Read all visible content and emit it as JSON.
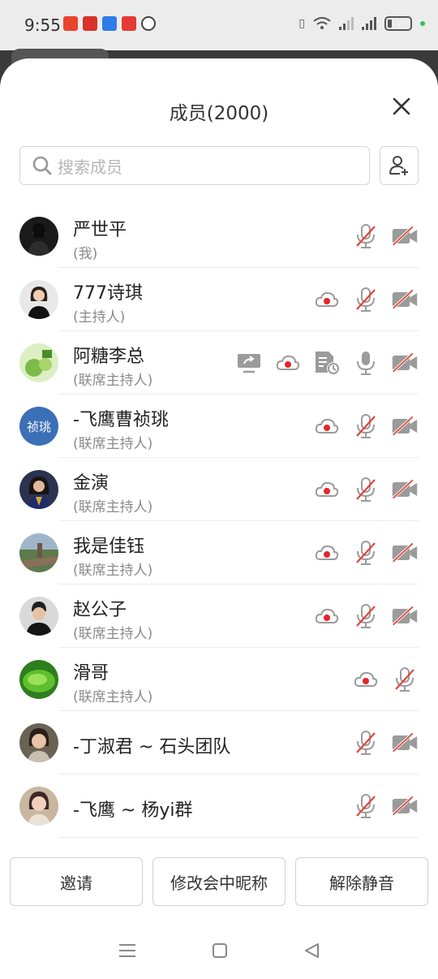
{
  "status_bar": {
    "time": "9:55"
  },
  "sheet": {
    "title": "成员(2000)",
    "search_placeholder": "搜索成员"
  },
  "members": [
    {
      "name": "严世平",
      "role": "(我)",
      "avatar_kind": "photo-dark",
      "icons": [
        "mic-muted-icon",
        "video-off-icon"
      ]
    },
    {
      "name": "777诗琪",
      "role": "(主持人)",
      "avatar_kind": "photo-light",
      "icons": [
        "cloud-record-icon",
        "mic-muted-icon",
        "video-off-icon"
      ]
    },
    {
      "name": "阿糖李总",
      "role": "(联席主持人)",
      "avatar_kind": "photo-green",
      "icons": [
        "screen-share-icon",
        "cloud-record-icon",
        "document-icon",
        "mic-icon",
        "video-off-icon"
      ]
    },
    {
      "name": "-飞鹰曹祯珧",
      "role": "(联席主持人)",
      "avatar_kind": "text",
      "avatar_text": "祯珧",
      "icons": [
        "cloud-record-icon",
        "mic-muted-icon",
        "video-off-icon"
      ]
    },
    {
      "name": "金演",
      "role": "(联席主持人)",
      "avatar_kind": "photo-blue",
      "icons": [
        "cloud-record-icon",
        "mic-muted-icon",
        "video-off-icon"
      ]
    },
    {
      "name": "我是佳钰",
      "role": "(联席主持人)",
      "avatar_kind": "photo-street",
      "icons": [
        "cloud-record-icon",
        "mic-muted-icon",
        "video-off-icon"
      ]
    },
    {
      "name": "赵公子",
      "role": "(联席主持人)",
      "avatar_kind": "photo-gray",
      "icons": [
        "cloud-record-icon",
        "mic-muted-icon",
        "video-off-icon"
      ]
    },
    {
      "name": "滑哥",
      "role": "(联席主持人)",
      "avatar_kind": "photo-grass",
      "icons": [
        "cloud-record-icon",
        "mic-muted-icon"
      ]
    },
    {
      "name": "-丁淑君 ~ 石头团队",
      "role": "",
      "avatar_kind": "photo-face",
      "icons": [
        "mic-muted-icon",
        "video-off-icon"
      ]
    },
    {
      "name": "-飞鹰 ~ 杨yi群",
      "role": "",
      "avatar_kind": "photo-face2",
      "icons": [
        "mic-muted-icon",
        "video-off-icon"
      ]
    }
  ],
  "buttons": {
    "invite": "邀请",
    "rename": "修改会中昵称",
    "unmute": "解除静音"
  },
  "colors": {
    "muted_red": "#e0453a",
    "icon_gray": "#9b9b9b",
    "record_red": "#e8232a",
    "text_avatar_blue": "#3b6fb6"
  }
}
